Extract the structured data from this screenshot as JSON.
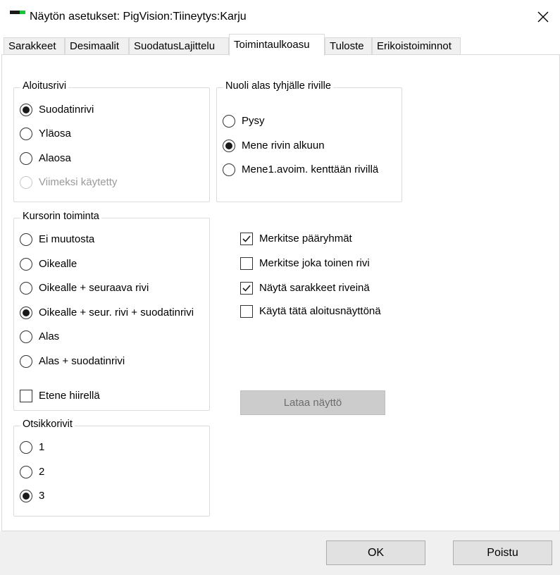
{
  "window": {
    "title": "Näytön asetukset: PigVision:Tiineytys:Karju",
    "icon": "app-icon",
    "close_icon": "close-icon"
  },
  "tabs": [
    {
      "label": "Sarakkeet",
      "active": false
    },
    {
      "label": "Desimaalit",
      "active": false
    },
    {
      "label": "SuodatusLajittelu",
      "active": false
    },
    {
      "label": "Toimintaulkoasu",
      "active": true
    },
    {
      "label": "Tuloste",
      "active": false
    },
    {
      "label": "Erikoistoiminnot",
      "active": false
    }
  ],
  "aloitusrivi": {
    "legend": "Aloitusrivi",
    "options": [
      {
        "label": "Suodatinrivi",
        "checked": true,
        "enabled": true
      },
      {
        "label": "Yläosa",
        "checked": false,
        "enabled": true
      },
      {
        "label": "Alaosa",
        "checked": false,
        "enabled": true
      },
      {
        "label": "Viimeksi käytetty",
        "checked": false,
        "enabled": false
      }
    ]
  },
  "nuoli": {
    "legend": "Nuoli alas tyhjälle riville",
    "options": [
      {
        "label": "Pysy",
        "checked": false
      },
      {
        "label": "Mene rivin alkuun",
        "checked": true
      },
      {
        "label": "Mene1.avoim. kenttään rivillä",
        "checked": false
      }
    ]
  },
  "kursori": {
    "legend": "Kursorin toiminta",
    "options": [
      {
        "label": "Ei muutosta",
        "checked": false
      },
      {
        "label": "Oikealle",
        "checked": false
      },
      {
        "label": "Oikealle + seuraava rivi",
        "checked": false
      },
      {
        "label": "Oikealle + seur. rivi + suodatinrivi",
        "checked": true
      },
      {
        "label": "Alas",
        "checked": false
      },
      {
        "label": "Alas + suodatinrivi",
        "checked": false
      }
    ],
    "etene_label": "Etene hiirellä",
    "etene_checked": false
  },
  "otsikkorivit": {
    "legend": "Otsikkorivit",
    "options": [
      {
        "label": "1",
        "checked": false
      },
      {
        "label": "2",
        "checked": false
      },
      {
        "label": "3",
        "checked": true
      }
    ]
  },
  "checkboxes": [
    {
      "label": "Merkitse pääryhmät",
      "checked": true
    },
    {
      "label": "Merkitse joka toinen rivi",
      "checked": false
    },
    {
      "label": "Näytä sarakkeet riveinä",
      "checked": true
    },
    {
      "label": "Käytä tätä aloitusnäyttönä",
      "checked": false
    }
  ],
  "lataa_button": "Lataa näyttö",
  "ok_button": "OK",
  "poistu_button": "Poistu"
}
